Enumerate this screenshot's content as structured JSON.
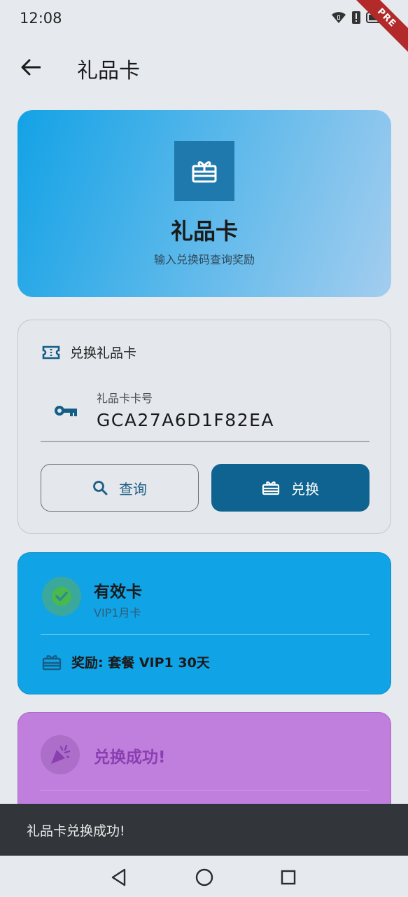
{
  "status_bar": {
    "time": "12:08",
    "badge": "PRE"
  },
  "app_bar": {
    "title": "礼品卡",
    "back_icon": "arrow-back-icon"
  },
  "hero": {
    "icon": "gift-card-icon",
    "title": "礼品卡",
    "subtitle": "输入兑换码查询奖励"
  },
  "redeem": {
    "section_title": "兑换礼品卡",
    "field_label": "礼品卡卡号",
    "field_value": "GCA27A6D1F82EA",
    "query_button": "查询",
    "redeem_button": "兑换"
  },
  "valid_card": {
    "status": "有效卡",
    "card_type": "VIP1月卡",
    "reward": "奖励: 套餐 VIP1 30天"
  },
  "success_card": {
    "title": "兑换成功!"
  },
  "snackbar": {
    "message": "礼品卡兑换成功!"
  },
  "colors": {
    "primary": "#0f6391",
    "valid_card_bg": "#10a3e6",
    "success_card_bg": "#c07fdc",
    "snackbar_bg": "#32353a"
  }
}
